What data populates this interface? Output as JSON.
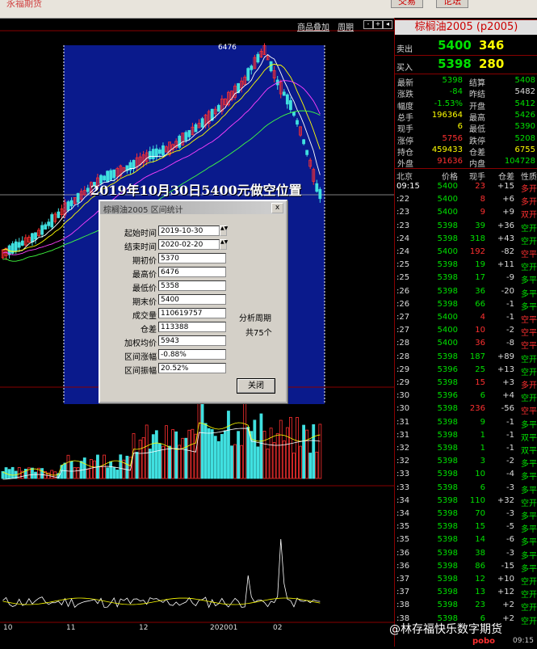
{
  "top": {
    "link": "永福期货",
    "btn_left": "交易",
    "btn_right": "论坛"
  },
  "toolbar": {
    "overlay_link": "商品叠加",
    "period_link": "周期",
    "btn_a": "-",
    "btn_b": "+",
    "btn_c": "◂",
    "btn_d": "▸"
  },
  "chart": {
    "high_label": "6476",
    "annotation": "2019年10月30日5400元做空位置",
    "x_ticks": [
      "10",
      "11",
      "12",
      "202001",
      "02"
    ]
  },
  "dialog": {
    "title": "棕榈油2005 区间统计",
    "close_icon": "x",
    "fields": [
      {
        "label": "起始时间",
        "value": "2019-10-30"
      },
      {
        "label": "结束时间",
        "value": "2020-02-20"
      },
      {
        "label": "期初价",
        "value": "5370"
      },
      {
        "label": "最高价",
        "value": "6476"
      },
      {
        "label": "最低价",
        "value": "5358"
      },
      {
        "label": "期末价",
        "value": "5400"
      },
      {
        "label": "成交量",
        "value": "110619757"
      },
      {
        "label": "仓差",
        "value": "113388"
      },
      {
        "label": "加权均价",
        "value": "5943"
      },
      {
        "label": "区间涨幅",
        "value": "-0.88%"
      },
      {
        "label": "区间振幅",
        "value": "20.52%"
      }
    ],
    "analysis_label": "分析周期",
    "analysis_value": "共75个",
    "close_button": "关闭"
  },
  "quote": {
    "title": "棕榈油2005 (p2005)",
    "sell_label": "卖出",
    "sell_price": "5400",
    "sell_vol": "346",
    "buy_label": "买入",
    "buy_price": "5398",
    "buy_vol": "280",
    "stats": [
      {
        "l1": "最新",
        "v1": "5398",
        "c1": "#00e000",
        "l2": "结算",
        "v2": "5408",
        "c2": "#00e000"
      },
      {
        "l1": "涨跌",
        "v1": "-84",
        "c1": "#00e000",
        "l2": "昨结",
        "v2": "5482",
        "c2": "#dddddd"
      },
      {
        "l1": "幅度",
        "v1": "-1.53%",
        "c1": "#00e000",
        "l2": "开盘",
        "v2": "5412",
        "c2": "#00e000"
      },
      {
        "l1": "总手",
        "v1": "196364",
        "c1": "#ffff00",
        "l2": "最高",
        "v2": "5426",
        "c2": "#00e000"
      },
      {
        "l1": "现手",
        "v1": "6",
        "c1": "#ffff00",
        "l2": "最低",
        "v2": "5390",
        "c2": "#00e000"
      },
      {
        "l1": "涨停",
        "v1": "5756",
        "c1": "#ff3030",
        "l2": "跌停",
        "v2": "5208",
        "c2": "#00e000"
      },
      {
        "l1": "持仓",
        "v1": "459433",
        "c1": "#ffff00",
        "l2": "仓差",
        "v2": "6755",
        "c2": "#ffff00"
      },
      {
        "l1": "外盘",
        "v1": "91636",
        "c1": "#ff3030",
        "l2": "内盘",
        "v2": "104728",
        "c2": "#00e000"
      }
    ],
    "headers": {
      "time": "北京",
      "price": "价格",
      "vol": "现手",
      "oi": "仓差",
      "nature": "性质"
    },
    "ticks": [
      {
        "t": "09:15",
        "p": "5400",
        "pc": "#00e000",
        "v": "23",
        "vc": "#ff3030",
        "o": "+15",
        "n": "多开",
        "nc": "#ff3030"
      },
      {
        "t": ":22",
        "p": "5400",
        "pc": "#00e000",
        "v": "8",
        "vc": "#ff3030",
        "o": "+6",
        "n": "多开",
        "nc": "#ff3030"
      },
      {
        "t": ":23",
        "p": "5400",
        "pc": "#00e000",
        "v": "9",
        "vc": "#ff3030",
        "o": "+9",
        "n": "双开",
        "nc": "#ff3030"
      },
      {
        "t": ":23",
        "p": "5398",
        "pc": "#00e000",
        "v": "39",
        "vc": "#00e000",
        "o": "+36",
        "n": "空开",
        "nc": "#00e000"
      },
      {
        "t": ":24",
        "p": "5398",
        "pc": "#00e000",
        "v": "318",
        "vc": "#00e000",
        "o": "+43",
        "n": "空开",
        "nc": "#00e000"
      },
      {
        "t": ":24",
        "p": "5400",
        "pc": "#00e000",
        "v": "192",
        "vc": "#ff3030",
        "o": "-82",
        "n": "空平",
        "nc": "#ff3030"
      },
      {
        "t": ":25",
        "p": "5398",
        "pc": "#00e000",
        "v": "19",
        "vc": "#00e000",
        "o": "+11",
        "n": "空开",
        "nc": "#00e000"
      },
      {
        "t": ":25",
        "p": "5398",
        "pc": "#00e000",
        "v": "17",
        "vc": "#00e000",
        "o": "-9",
        "n": "多平",
        "nc": "#00e000"
      },
      {
        "t": ":26",
        "p": "5398",
        "pc": "#00e000",
        "v": "36",
        "vc": "#00e000",
        "o": "-20",
        "n": "多平",
        "nc": "#00e000"
      },
      {
        "t": ":26",
        "p": "5398",
        "pc": "#00e000",
        "v": "66",
        "vc": "#00e000",
        "o": "-1",
        "n": "多平",
        "nc": "#00e000"
      },
      {
        "t": ":27",
        "p": "5400",
        "pc": "#00e000",
        "v": "4",
        "vc": "#ff3030",
        "o": "-1",
        "n": "空平",
        "nc": "#ff3030"
      },
      {
        "t": ":27",
        "p": "5400",
        "pc": "#00e000",
        "v": "10",
        "vc": "#ff3030",
        "o": "-2",
        "n": "空平",
        "nc": "#ff3030"
      },
      {
        "t": ":28",
        "p": "5400",
        "pc": "#00e000",
        "v": "36",
        "vc": "#ff3030",
        "o": "-8",
        "n": "空平",
        "nc": "#ff3030"
      },
      {
        "t": ":28",
        "p": "5398",
        "pc": "#00e000",
        "v": "187",
        "vc": "#00e000",
        "o": "+89",
        "n": "空开",
        "nc": "#00e000"
      },
      {
        "t": ":29",
        "p": "5396",
        "pc": "#00e000",
        "v": "25",
        "vc": "#00e000",
        "o": "+13",
        "n": "空开",
        "nc": "#00e000"
      },
      {
        "t": ":29",
        "p": "5398",
        "pc": "#00e000",
        "v": "15",
        "vc": "#ff3030",
        "o": "+3",
        "n": "多开",
        "nc": "#ff3030"
      },
      {
        "t": ":30",
        "p": "5396",
        "pc": "#00e000",
        "v": "6",
        "vc": "#00e000",
        "o": "+4",
        "n": "空开",
        "nc": "#00e000"
      },
      {
        "t": ":30",
        "p": "5398",
        "pc": "#00e000",
        "v": "236",
        "vc": "#ff3030",
        "o": "-56",
        "n": "空平",
        "nc": "#ff3030"
      },
      {
        "t": ":31",
        "p": "5398",
        "pc": "#00e000",
        "v": "9",
        "vc": "#00e000",
        "o": "-1",
        "n": "多平",
        "nc": "#00e000"
      },
      {
        "t": ":31",
        "p": "5398",
        "pc": "#00e000",
        "v": "1",
        "vc": "#00e000",
        "o": "-1",
        "n": "双平",
        "nc": "#00e000"
      },
      {
        "t": ":32",
        "p": "5398",
        "pc": "#00e000",
        "v": "1",
        "vc": "#00e000",
        "o": "-1",
        "n": "双平",
        "nc": "#00e000"
      },
      {
        "t": ":32",
        "p": "5398",
        "pc": "#00e000",
        "v": "3",
        "vc": "#00e000",
        "o": "-2",
        "n": "多平",
        "nc": "#00e000"
      },
      {
        "t": ":33",
        "p": "5398",
        "pc": "#00e000",
        "v": "10",
        "vc": "#00e000",
        "o": "-4",
        "n": "多平",
        "nc": "#00e000"
      },
      {
        "t": ":33",
        "p": "5398",
        "pc": "#00e000",
        "v": "6",
        "vc": "#00e000",
        "o": "-3",
        "n": "多平",
        "nc": "#00e000"
      },
      {
        "t": ":34",
        "p": "5398",
        "pc": "#00e000",
        "v": "110",
        "vc": "#00e000",
        "o": "+32",
        "n": "空开",
        "nc": "#00e000"
      },
      {
        "t": ":34",
        "p": "5398",
        "pc": "#00e000",
        "v": "70",
        "vc": "#00e000",
        "o": "-3",
        "n": "多平",
        "nc": "#00e000"
      },
      {
        "t": ":35",
        "p": "5398",
        "pc": "#00e000",
        "v": "15",
        "vc": "#00e000",
        "o": "-5",
        "n": "多平",
        "nc": "#00e000"
      },
      {
        "t": ":35",
        "p": "5398",
        "pc": "#00e000",
        "v": "14",
        "vc": "#00e000",
        "o": "-6",
        "n": "多平",
        "nc": "#00e000"
      },
      {
        "t": ":36",
        "p": "5398",
        "pc": "#00e000",
        "v": "38",
        "vc": "#00e000",
        "o": "-3",
        "n": "多平",
        "nc": "#00e000"
      },
      {
        "t": ":36",
        "p": "5398",
        "pc": "#00e000",
        "v": "86",
        "vc": "#00e000",
        "o": "-15",
        "n": "多平",
        "nc": "#00e000"
      },
      {
        "t": ":37",
        "p": "5398",
        "pc": "#00e000",
        "v": "12",
        "vc": "#00e000",
        "o": "+10",
        "n": "空开",
        "nc": "#00e000"
      },
      {
        "t": ":37",
        "p": "5398",
        "pc": "#00e000",
        "v": "13",
        "vc": "#00e000",
        "o": "+12",
        "n": "空开",
        "nc": "#00e000"
      },
      {
        "t": ":38",
        "p": "5398",
        "pc": "#00e000",
        "v": "23",
        "vc": "#00e000",
        "o": "+2",
        "n": "空开",
        "nc": "#00e000"
      },
      {
        "t": ":38",
        "p": "5398",
        "pc": "#00e000",
        "v": "6",
        "vc": "#00e000",
        "o": "+2",
        "n": "空开",
        "nc": "#00e000"
      }
    ]
  },
  "status": {
    "brand": "pobo",
    "time": "09:15"
  },
  "watermark": "@林存福快乐数字期货"
}
